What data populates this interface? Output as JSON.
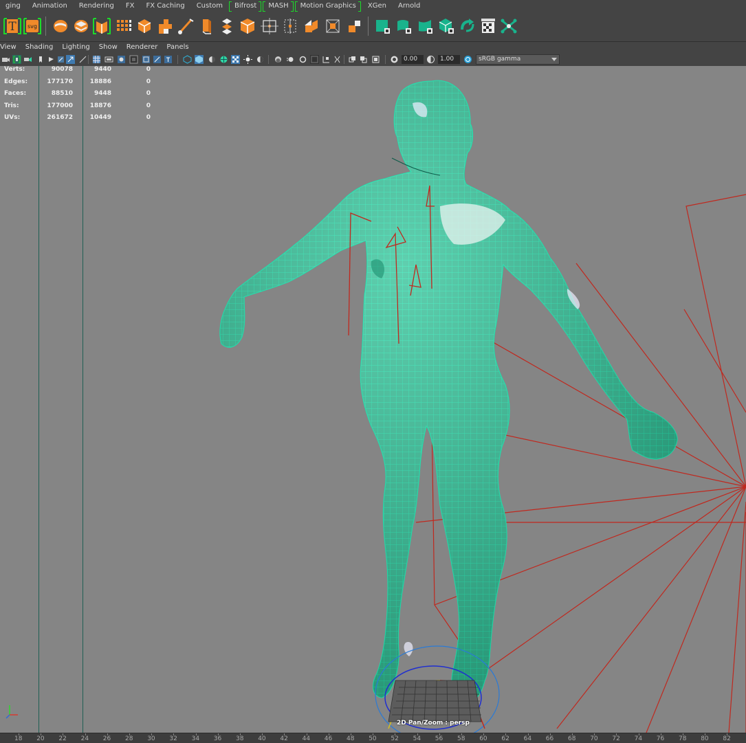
{
  "shelf_tabs": [
    {
      "label": "ging",
      "marked": false
    },
    {
      "label": "Animation",
      "marked": false
    },
    {
      "label": "Rendering",
      "marked": false
    },
    {
      "label": "FX",
      "marked": false
    },
    {
      "label": "FX Caching",
      "marked": false
    },
    {
      "label": "Custom",
      "marked": false
    },
    {
      "label": "Bifrost",
      "marked": true
    },
    {
      "label": "MASH",
      "marked": true
    },
    {
      "label": "Motion Graphics",
      "marked": true
    },
    {
      "label": "XGen",
      "marked": false
    },
    {
      "label": "Arnold",
      "marked": false
    }
  ],
  "shelf": {
    "text_tool_label": "T",
    "svg_tool_label": "svg",
    "icons": [
      "type-tool-icon",
      "svg-tool-icon",
      "bevel-plus-icon",
      "sweep-mesh-icon",
      "mash-network-icon",
      "grid-icon",
      "cube-icon",
      "cube-grid-icon",
      "brush-icon",
      "extrude-icon",
      "duplicate-icon",
      "polycube-icon",
      "bounding-box-icon",
      "bounding-dots-icon",
      "split-icon",
      "tiles-icon",
      "curve-warp-icon",
      "flag-icon",
      "deformer-icon",
      "fracture-icon",
      "refresh-icon",
      "checker-icon",
      "connect-icon"
    ]
  },
  "menubar": [
    "View",
    "Shading",
    "Lighting",
    "Show",
    "Renderer",
    "Panels"
  ],
  "panel_toolbar": {
    "exposure_value": "0.00",
    "gamma_value": "1.00",
    "color_space": "sRGB gamma"
  },
  "hud": {
    "rows": [
      {
        "label": "Verts:",
        "v1": "90078",
        "v2": "9440",
        "v3": "0"
      },
      {
        "label": "Edges:",
        "v1": "177170",
        "v2": "18886",
        "v3": "0"
      },
      {
        "label": "Faces:",
        "v1": "88510",
        "v2": "9448",
        "v3": "0"
      },
      {
        "label": "Tris:",
        "v1": "177000",
        "v2": "18876",
        "v3": "0"
      },
      {
        "label": "UVs:",
        "v1": "261672",
        "v2": "10449",
        "v3": "0"
      }
    ]
  },
  "viewport": {
    "camera_label": "2D Pan/Zoom : persp",
    "mesh_color": "#2fd6a4",
    "wire_color": "#15e6b0",
    "joint_color": "#c0281e"
  },
  "timeline": {
    "ticks": [
      "18",
      "20",
      "22",
      "24",
      "26",
      "28",
      "30",
      "32",
      "34",
      "36",
      "38",
      "40",
      "42",
      "44",
      "46",
      "48",
      "50",
      "52",
      "54",
      "56",
      "58",
      "60",
      "62",
      "64",
      "66",
      "68",
      "70",
      "72",
      "74",
      "76",
      "78",
      "80",
      "82"
    ]
  }
}
